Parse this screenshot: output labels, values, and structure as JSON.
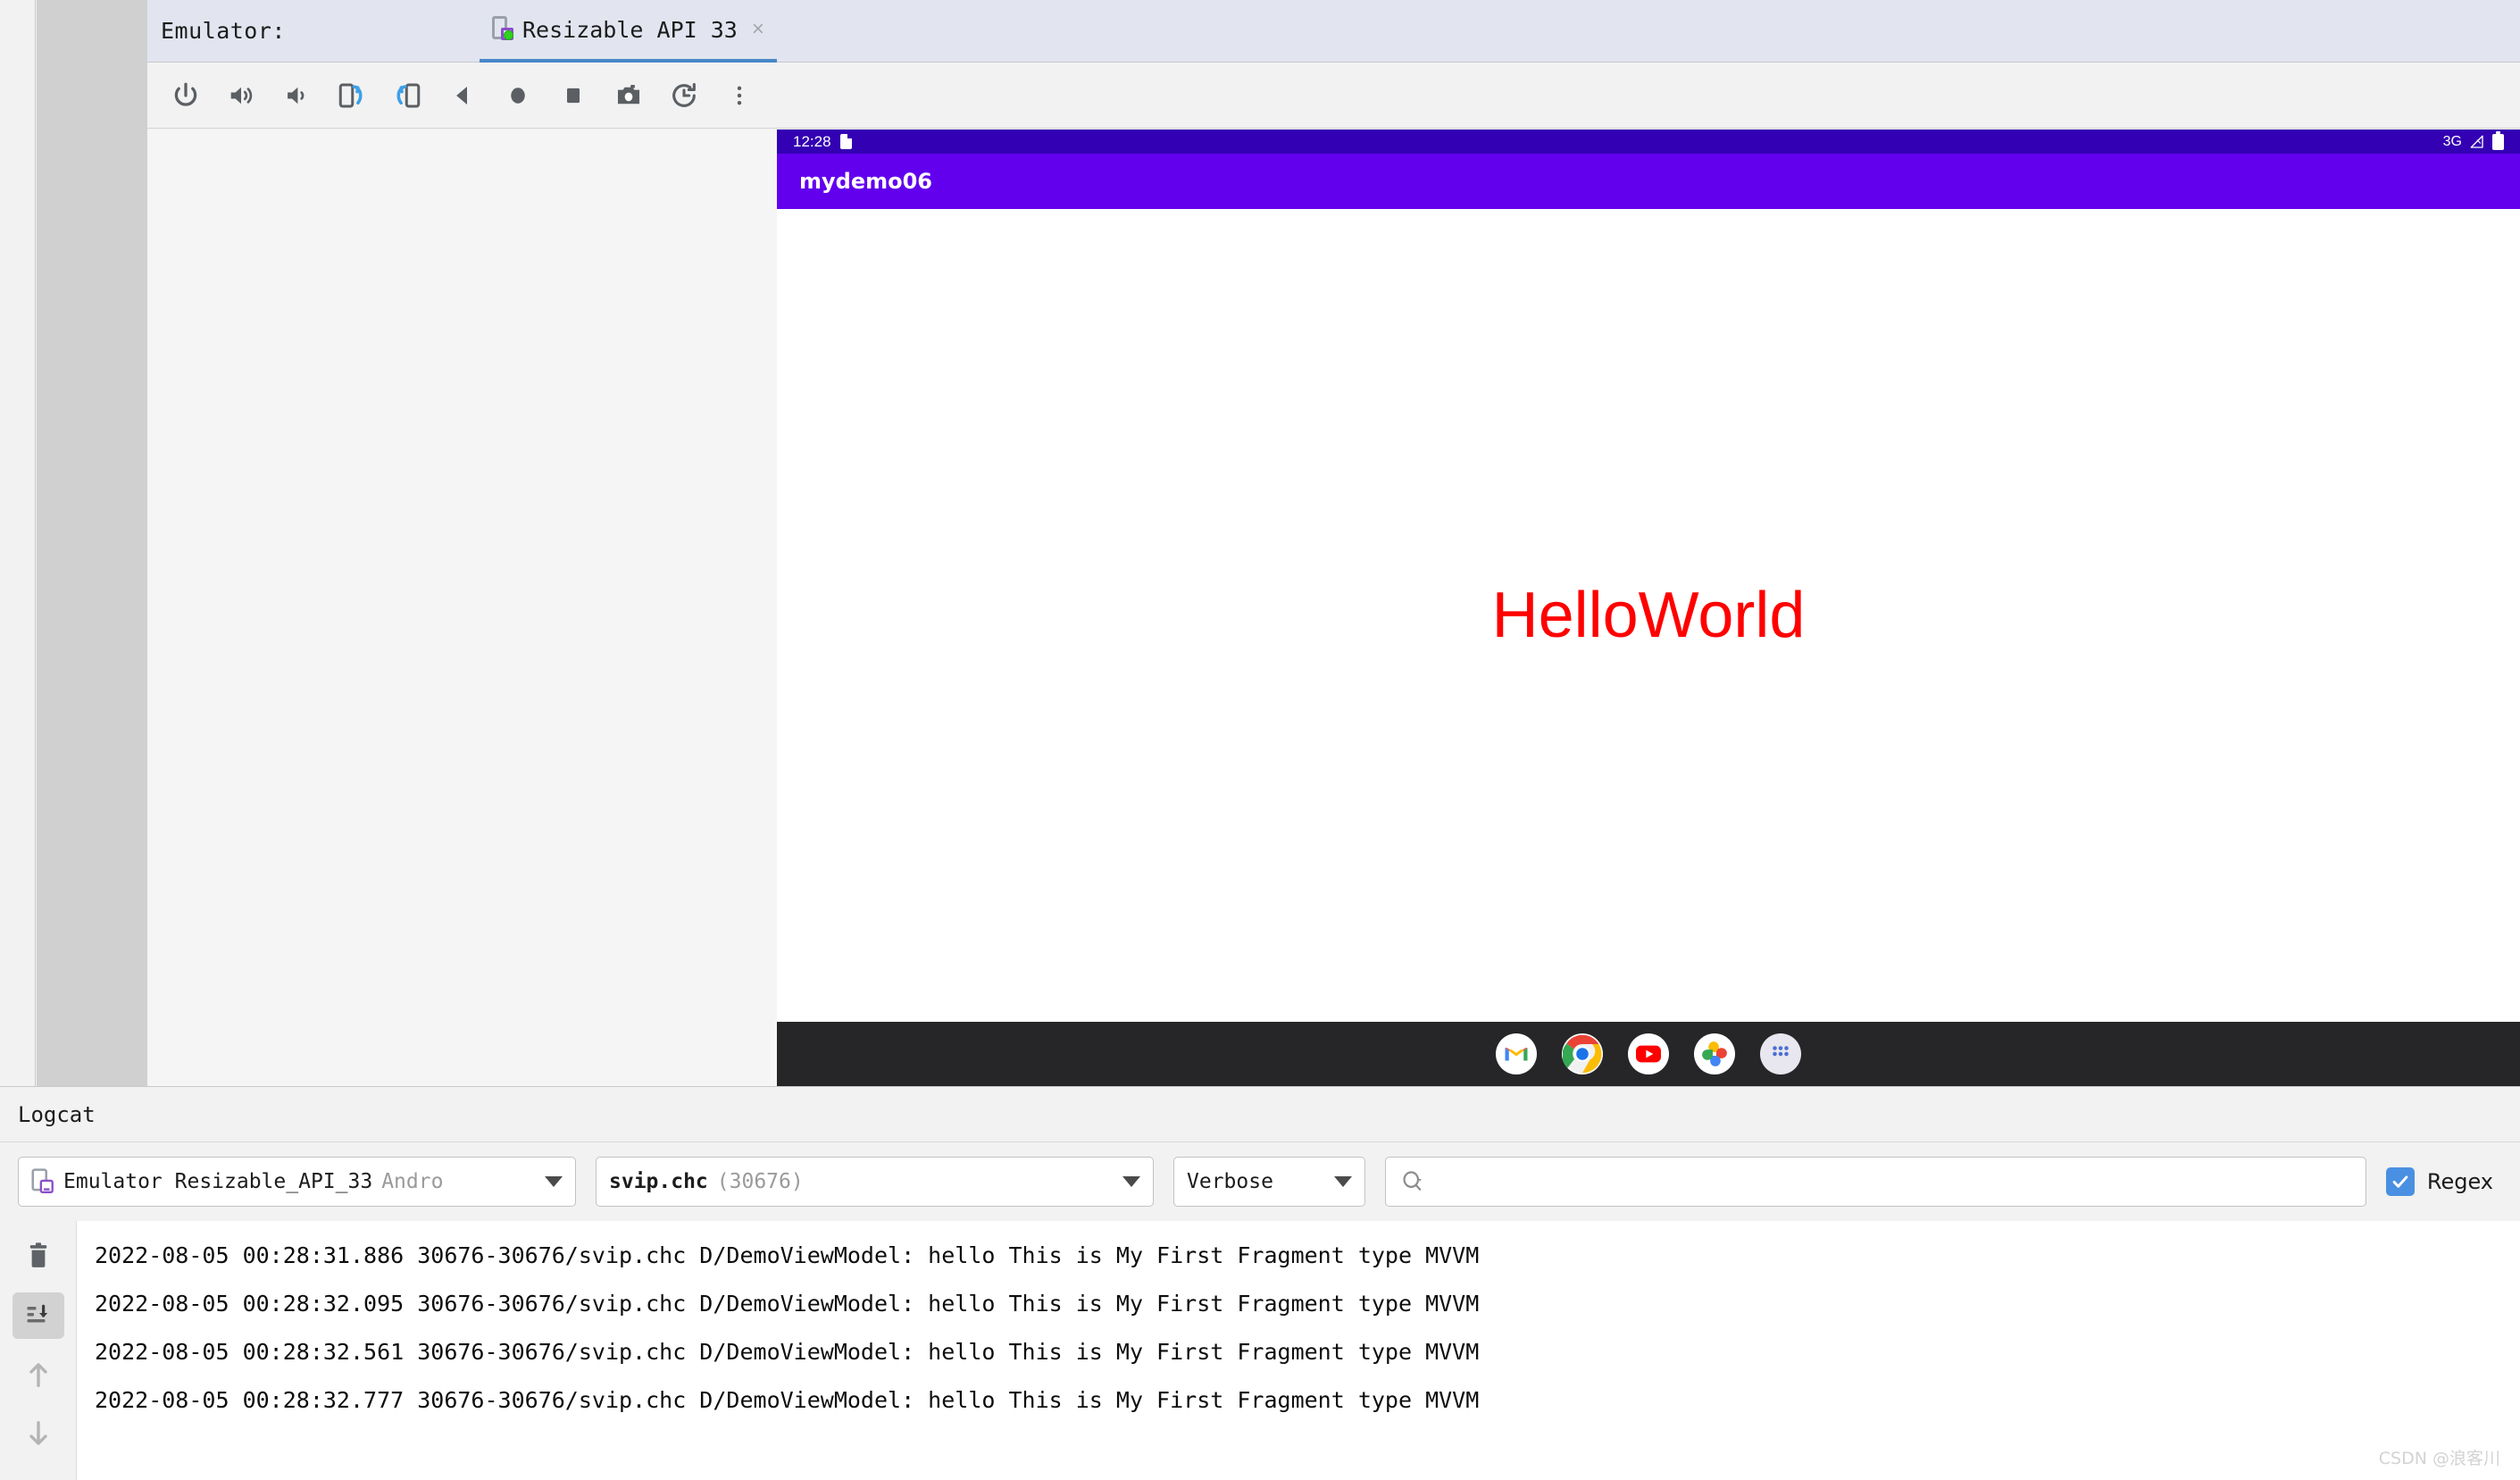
{
  "window": {
    "emulator_label": "Emulator:",
    "tab": {
      "title": "Resizable API 33",
      "close_label": "×",
      "device_icon": "device-running-icon"
    }
  },
  "toolbar": {
    "buttons": [
      {
        "name": "power-button",
        "icon": "power-icon"
      },
      {
        "name": "volume-up-button",
        "icon": "volume-up-icon"
      },
      {
        "name": "volume-down-button",
        "icon": "volume-down-icon"
      },
      {
        "name": "rotate-left-button",
        "icon": "rotate-left-icon"
      },
      {
        "name": "rotate-right-button",
        "icon": "rotate-right-icon"
      },
      {
        "name": "back-button",
        "icon": "triangle-back-icon"
      },
      {
        "name": "home-button",
        "icon": "circle-home-icon"
      },
      {
        "name": "overview-button",
        "icon": "square-overview-icon"
      },
      {
        "name": "screenshot-button",
        "icon": "camera-icon"
      },
      {
        "name": "rotate-history-button",
        "icon": "clock-rotate-icon"
      },
      {
        "name": "more-options-button",
        "icon": "vertical-dots-icon"
      }
    ]
  },
  "device": {
    "statusbar": {
      "time": "12:28",
      "sim_icon": "sim-card-icon",
      "network": "3G",
      "signal_icon": "signal-bars-icon",
      "battery_icon": "battery-icon"
    },
    "actionbar": {
      "title": "mydemo06",
      "color": "#6200ee"
    },
    "content": {
      "text": "HelloWorld",
      "text_color": "#ff0000"
    },
    "dock": [
      {
        "name": "gmail-icon",
        "label": "Gmail"
      },
      {
        "name": "chrome-icon",
        "label": "Chrome"
      },
      {
        "name": "youtube-icon",
        "label": "YouTube"
      },
      {
        "name": "google-photos-icon",
        "label": "Photos"
      },
      {
        "name": "app-drawer-icon",
        "label": "All apps"
      }
    ]
  },
  "logcat": {
    "title": "Logcat",
    "device_selector": {
      "text": "Emulator Resizable_API_33 ",
      "suffix": "Andro"
    },
    "process_selector": {
      "package": "svip.chc",
      "pid": "(30676)"
    },
    "level_selector": "Verbose",
    "search": {
      "value": "",
      "placeholder": ""
    },
    "regex": {
      "label": "Regex",
      "checked": true,
      "color": "#4a90e2"
    },
    "gutter_buttons": [
      {
        "name": "clear-logcat-button",
        "icon": "trash-icon",
        "active": false
      },
      {
        "name": "scroll-to-end-button",
        "icon": "scroll-to-end-icon",
        "active": true
      },
      {
        "name": "previous-occurrence-button",
        "icon": "arrow-up-icon",
        "active": false
      },
      {
        "name": "next-occurrence-button",
        "icon": "arrow-down-icon",
        "active": false
      }
    ],
    "lines": [
      "2022-08-05 00:28:31.886 30676-30676/svip.chc D/DemoViewModel: hello This is My First Fragment type MVVM",
      "2022-08-05 00:28:32.095 30676-30676/svip.chc D/DemoViewModel: hello This is My First Fragment type MVVM",
      "2022-08-05 00:28:32.561 30676-30676/svip.chc D/DemoViewModel: hello This is My First Fragment type MVVM",
      "2022-08-05 00:28:32.777 30676-30676/svip.chc D/DemoViewModel: hello This is My First Fragment type MVVM"
    ]
  },
  "watermark": "CSDN @浪客川"
}
